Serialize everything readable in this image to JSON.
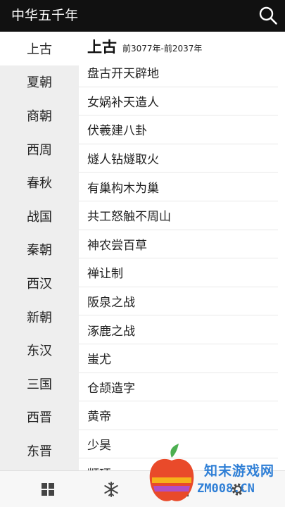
{
  "app": {
    "title": "中华五千年"
  },
  "icons": {
    "search": "search-icon",
    "home": "grid-icon",
    "snow": "snowflake-icon",
    "doc": "document-icon",
    "settings": "gear-icon"
  },
  "sidebar": {
    "items": [
      {
        "label": "上古",
        "active": true
      },
      {
        "label": "夏朝"
      },
      {
        "label": "商朝"
      },
      {
        "label": "西周"
      },
      {
        "label": "春秋"
      },
      {
        "label": "战国"
      },
      {
        "label": "秦朝"
      },
      {
        "label": "西汉"
      },
      {
        "label": "新朝"
      },
      {
        "label": "东汉"
      },
      {
        "label": "三国"
      },
      {
        "label": "西晋"
      },
      {
        "label": "东晋"
      }
    ]
  },
  "content": {
    "era_name": "上古",
    "era_range": "前3077年-前2037年",
    "events": [
      "盘古开天辟地",
      "女娲补天造人",
      "伏羲建八卦",
      "燧人钻燧取火",
      "有巢构木为巢",
      "共工怒触不周山",
      "神农尝百草",
      "禅让制",
      "阪泉之战",
      "涿鹿之战",
      "蚩尤",
      "仓颉造字",
      "黄帝",
      "少昊",
      "颛顼"
    ]
  },
  "watermark": {
    "cn": "知末游戏网",
    "en": "ZM008.CN"
  },
  "colors": {
    "topbar": "#111111",
    "sidebar": "#eeeeee",
    "watermark": "#2f7fd6"
  }
}
